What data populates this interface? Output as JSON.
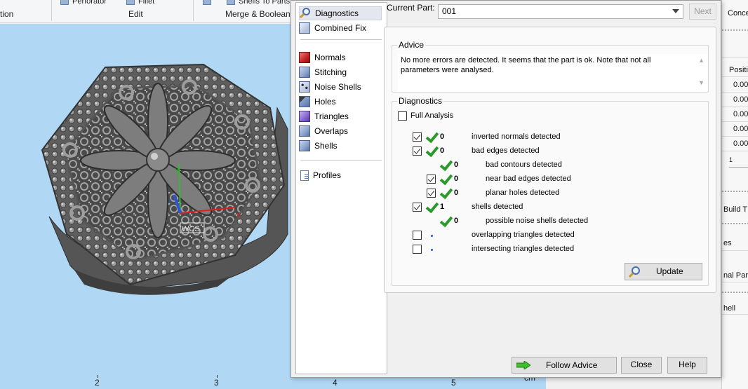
{
  "ribbon": {
    "items": [
      "Perforator",
      "Fillet",
      "Shells To Parts"
    ],
    "groups": [
      "tion",
      "Edit",
      "Merge & Boolean"
    ]
  },
  "ruler": {
    "ticks": [
      "2",
      "3",
      "4",
      "5"
    ],
    "unit": "cm"
  },
  "axes": {
    "x": "x",
    "y": "y",
    "z": "z",
    "frame": "WCS"
  },
  "side_panel": {
    "tab": "Conce",
    "column_header": "Positi",
    "values": [
      "0.00",
      "0.00",
      "0.00",
      "0.00",
      "0.00"
    ],
    "slider_value": "1",
    "items": [
      "Build T",
      "es",
      "nal Part",
      "hell"
    ]
  },
  "dialog": {
    "categories": [
      {
        "label": "Diagnostics",
        "icon": "diagnostics-magnifier-icon",
        "selected": true
      },
      {
        "label": "Combined Fix",
        "icon": "combined-fix-cube-icon"
      },
      {
        "label": "Normals",
        "icon": "normals-cube-icon"
      },
      {
        "label": "Stitching",
        "icon": "stitching-cube-icon"
      },
      {
        "label": "Noise Shells",
        "icon": "noise-shells-cube-icon"
      },
      {
        "label": "Holes",
        "icon": "holes-cube-icon"
      },
      {
        "label": "Triangles",
        "icon": "triangles-cube-icon"
      },
      {
        "label": "Overlaps",
        "icon": "overlaps-cube-icon"
      },
      {
        "label": "Shells",
        "icon": "shells-cube-icon"
      },
      {
        "label": "Profiles",
        "icon": "profiles-document-icon"
      }
    ],
    "current_part_label": "Current Part:",
    "current_part_value": "001",
    "next_label": "Next",
    "advice_title": "Advice",
    "advice_text": "No more errors are detected. It seems that the part is ok. Note that not all parameters were analysed.",
    "diagnostics_title": "Diagnostics",
    "full_analysis_label": "Full Analysis",
    "rows": [
      {
        "count": "0",
        "text": "inverted normals detected"
      },
      {
        "count": "0",
        "text": "bad edges detected"
      },
      {
        "count": "0",
        "text": "bad contours detected"
      },
      {
        "count": "0",
        "text": "near bad edges detected"
      },
      {
        "count": "0",
        "text": "planar holes detected"
      },
      {
        "count": "1",
        "text": "shells detected"
      },
      {
        "count": "0",
        "text": "possible noise shells detected"
      },
      {
        "count": "",
        "text": "overlapping triangles detected"
      },
      {
        "count": "",
        "text": "intersecting triangles detected"
      }
    ],
    "update_label": "Update",
    "follow_advice_label": "Follow Advice",
    "close_label": "Close",
    "help_label": "Help"
  },
  "colors": {
    "viewport": "#b0d8f5",
    "check_green": "#2b9a2b",
    "axis_x": "#e02020",
    "axis_y": "#39b539",
    "axis_z": "#2f55d4"
  }
}
